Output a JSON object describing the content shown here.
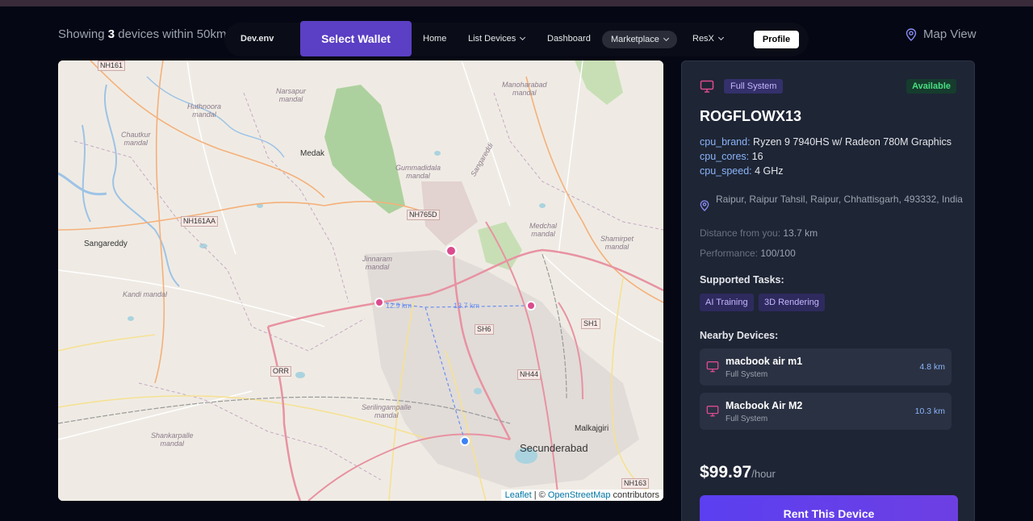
{
  "header": {
    "showing_prefix": "Showing",
    "device_count": "3",
    "showing_suffix": "devices  within 50km",
    "map_view_label": "Map View"
  },
  "nav": {
    "brand": "Dev.env",
    "select_wallet": "Select Wallet",
    "home": "Home",
    "list_devices": "List Devices",
    "dashboard": "Dashboard",
    "marketplace": "Marketplace",
    "resx": "ResX",
    "profile": "Profile"
  },
  "map": {
    "labels": {
      "nh161_top": "NH161",
      "hathnoora": "Hathnoora\nmandal",
      "narsapur": "Narsapur\nmandal",
      "manoharabad": "Manoharabad\nmandal",
      "chautkur": "Chautkur\nmandal",
      "medak": "Medak",
      "gummadidala": "Gummadidala\nmandal",
      "sangareddi_road": "Sangareddi",
      "nh161aa": "NH161AA",
      "nh765d": "NH765D",
      "medchal": "Medchal\nmandal",
      "shamirpet": "Shamirpet\nmandal",
      "sangareddy": "Sangareddy",
      "jinnaram": "Jinnaram\nmandal",
      "kandi": "Kandi mandal",
      "sh6": "SH6",
      "sh1": "SH1",
      "orr": "ORR",
      "nh44": "NH44",
      "serilingampalle": "Serilingampalle\nmandal",
      "shankarpalle": "Shankarpalle\nmandal",
      "secunderabad": "Secunderabad",
      "malkajgiri": "Malkajgiri",
      "nh163": "NH163",
      "dist_label_1": "12.9 km",
      "dist_label_2": "13.7 km"
    },
    "attribution": {
      "leaflet": "Leaflet",
      "separator": " | © ",
      "osm": "OpenStreetMap",
      "contributors": " contributors"
    }
  },
  "device": {
    "type_badge": "Full System",
    "status_badge": "Available",
    "name": "ROGFLOWX13",
    "specs": [
      {
        "key": "cpu_brand:",
        "value": " Ryzen 9 7940HS w/ Radeon 780M Graphics"
      },
      {
        "key": "cpu_cores:",
        "value": " 16"
      },
      {
        "key": "cpu_speed:",
        "value": " 4 GHz"
      }
    ],
    "location": "Raipur, Raipur Tahsil, Raipur, Chhattisgarh, 493332, India",
    "distance_label": "Distance from you:",
    "distance_value": " 13.7 km",
    "performance_label": "Performance:",
    "performance_value": " 100/100",
    "supported_tasks_title": "Supported Tasks:",
    "tasks": [
      "AI Training",
      "3D Rendering"
    ],
    "nearby_title": "Nearby Devices:",
    "nearby": [
      {
        "name": "macbook air m1",
        "type": "Full System",
        "distance": "4.8 km"
      },
      {
        "name": "Macbook Air M2",
        "type": "Full System",
        "distance": "10.3 km"
      }
    ],
    "price": "$99.97",
    "price_unit": "/hour",
    "rent_label": "Rent This Device"
  },
  "colors": {
    "accent": "#5b3fc4",
    "pink_marker": "#db4b8e",
    "blue_marker": "#3b82f6",
    "available": "#4ade80"
  }
}
